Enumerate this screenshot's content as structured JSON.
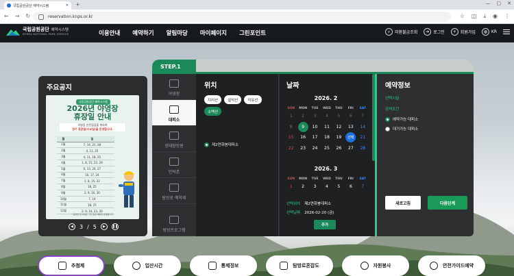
{
  "browser": {
    "tab_title": "국립공원공단 예약시스템",
    "url": "reservation.knps.or.kr"
  },
  "header": {
    "logo_name": "국립공원공단",
    "logo_sub": "예약시스템",
    "logo_eng": "KOREA NATIONAL PARK SERVICE",
    "nav": [
      "이용안내",
      "예약하기",
      "알림마당",
      "마이페이지",
      "그린포인트"
    ],
    "util": {
      "lost": "미환불금조회",
      "login": "로그인",
      "join": "회원가입",
      "lang": "KR"
    }
  },
  "notice": {
    "title": "주요공지",
    "poster": {
      "badge": "국립공원공단 예약시스템",
      "title_line1": "2026년 야영장",
      "title_line2": "휴장일 안내",
      "desc_line1": "야영장 안전점검을 위하여",
      "desc_line2": "정기 휴장일(수요일)을 운영합니다.",
      "col_month": "월",
      "col_day": "일",
      "rows": [
        [
          "1월",
          "7, 14, 21, 28"
        ],
        [
          "2월",
          "4, 11, 25"
        ],
        [
          "3월",
          "4, 11, 18, 25"
        ],
        [
          "4월",
          "1, 8, 15, 22, 29"
        ],
        [
          "5월",
          "6, 13, 20, 27"
        ],
        [
          "6월",
          "10, 17, 24"
        ],
        [
          "7월",
          "1, 8, 15, 22"
        ],
        [
          "8월",
          "18, 25"
        ],
        [
          "9월",
          "2, 9, 16, 30"
        ],
        [
          "10월",
          "7, 14"
        ],
        [
          "11월",
          "18, 25"
        ],
        [
          "12월",
          "2, 9, 16, 23, 30"
        ]
      ],
      "foot": "* 공휴일 및 이벤트 기간 등은 예외로 운영됩니다."
    },
    "pager": {
      "current": "3",
      "total": "5",
      "sep": "/"
    }
  },
  "step": {
    "label": "STEP.1"
  },
  "categories": [
    "야영장",
    "대피소",
    "생태탐방원",
    "민박촌",
    "탐방로 예약제",
    "탐방프로그램"
  ],
  "location": {
    "title": "위치",
    "chips": [
      "지리산",
      "설악산",
      "덕유산",
      "소백산"
    ],
    "selected_chip": "소백산",
    "facility": "제2연화봉대피소"
  },
  "date": {
    "title": "날짜",
    "weekdays": [
      "SUN",
      "MON",
      "TUE",
      "WED",
      "THU",
      "FRI",
      "SAT"
    ],
    "month1": {
      "label": "2026. 2",
      "weeks": [
        [
          "1",
          "2",
          "3",
          "4",
          "5",
          "6",
          "7"
        ],
        [
          "8",
          "9",
          "10",
          "11",
          "12",
          "13",
          "14"
        ],
        [
          "15",
          "16",
          "17",
          "18",
          "19",
          "20",
          "21"
        ],
        [
          "22",
          "23",
          "24",
          "25",
          "26",
          "27",
          "28"
        ]
      ],
      "today": "9",
      "selected": "20",
      "selected_label": "선택",
      "disabled": [
        "1",
        "2",
        "3",
        "4",
        "5",
        "6",
        "7",
        "8"
      ]
    },
    "month2": {
      "label": "2026. 3",
      "weeks": [
        [
          "1",
          "2",
          "3",
          "4",
          "5",
          "6",
          "7"
        ]
      ]
    },
    "summary": {
      "loc_label": "선택위치",
      "loc_value": "제2연화봉대피소",
      "date_label": "선택날짜",
      "date_value": "2026-02-20 (금)"
    },
    "add_button": "추가"
  },
  "reservation": {
    "title": "예약정보",
    "facility_label": "선택시설",
    "condition_label": "검색조건",
    "options": [
      "예약가능 대피소",
      "대기가능 대피소"
    ],
    "reset": "새로고침",
    "next": "다음단계"
  },
  "quick_links": [
    "추첨제",
    "입산시간",
    "통제정보",
    "탐방로혼잡도",
    "자원봉사",
    "안전가이드예약"
  ],
  "colors": {
    "accent": "#1a8a5a",
    "header_bg": "#161a1d",
    "panel_bg": "#2d2f31",
    "sunday": "#e04848",
    "saturday": "#3b8bf0",
    "selected_date": "#1e6fe0"
  }
}
